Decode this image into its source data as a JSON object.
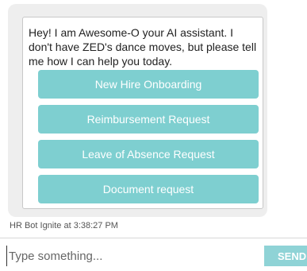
{
  "bot_message": {
    "text": "Hey! I am Awesome-O your AI assistant. I don't have ZED's dance moves, but please tell me how I can help you today.",
    "options": [
      "New Hire Onboarding",
      "Reimbursement Request",
      "Leave of Absence Request",
      "Document request"
    ]
  },
  "meta": {
    "sender_timestamp": "HR Bot Ignite at 3:38:27 PM"
  },
  "composer": {
    "placeholder": "Type something...",
    "send_label": "SEND"
  },
  "colors": {
    "option_button_bg": "#7ecfd0",
    "send_button_bg": "#8fd3d6",
    "bubble_bg": "#eeeeee"
  }
}
